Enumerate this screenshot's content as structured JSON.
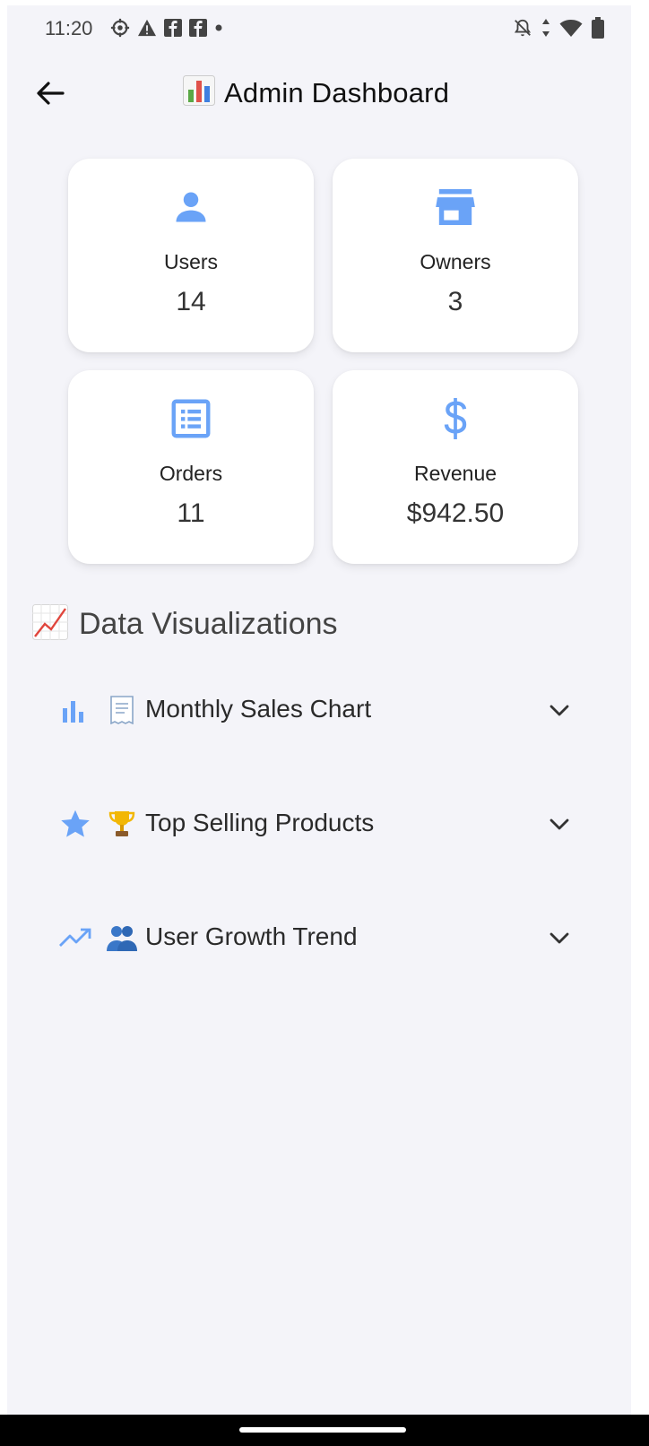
{
  "status_bar": {
    "time": "11:20",
    "left_icons": [
      "settings-icon",
      "warning-icon",
      "facebook-icon",
      "facebook-icon",
      "dot-icon"
    ],
    "right_icons": [
      "notifications-off-icon",
      "data-arrows-icon",
      "wifi-icon",
      "battery-icon"
    ]
  },
  "app_bar": {
    "back_icon": "arrow-back-icon",
    "title_emoji": "📊",
    "title": "Admin Dashboard"
  },
  "stats": [
    {
      "icon": "person-icon",
      "label": "Users",
      "value": "14"
    },
    {
      "icon": "store-icon",
      "label": "Owners",
      "value": "3"
    },
    {
      "icon": "list-icon",
      "label": "Orders",
      "value": "11"
    },
    {
      "icon": "dollar-icon",
      "label": "Revenue",
      "value": "$942.50"
    }
  ],
  "section": {
    "emoji": "📈",
    "title": "Data Visualizations"
  },
  "expanders": [
    {
      "icon": "bar-chart-icon",
      "emoji": "🧾",
      "label": "Monthly Sales Chart"
    },
    {
      "icon": "star-icon",
      "emoji": "🏆",
      "label": "Top Selling Products"
    },
    {
      "icon": "trending-up-icon",
      "emoji": "👥",
      "label": "User Growth Trend"
    }
  ],
  "colors": {
    "accent": "#6aa3f7",
    "background": "#f4f4f9",
    "card": "#ffffff",
    "text": "#222222"
  }
}
